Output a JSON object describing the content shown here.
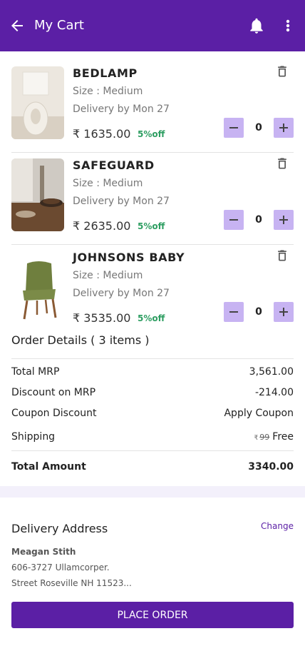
{
  "header": {
    "title": "My Cart",
    "background": "#5b1fa5",
    "icons": [
      "back-arrow-icon",
      "bell-icon",
      "more-vert-icon"
    ]
  },
  "cart": {
    "items": [
      {
        "name": "BEDLAMP",
        "size": "Size : Medium",
        "delivery": "Delivery by Mon 27",
        "price": "₹ 1635.00",
        "discount": "5%off",
        "quantity": "0"
      },
      {
        "name": "SAFEGUARD",
        "size": "Size : Medium",
        "delivery": "Delivery by Mon 27",
        "price": "₹ 2635.00",
        "discount": "5%off",
        "quantity": "0"
      },
      {
        "name": "JOHNSONS BABY",
        "size": "Size : Medium",
        "delivery": "Delivery by Mon 27",
        "price": "₹ 3535.00",
        "discount": "5%off",
        "quantity": "0"
      }
    ]
  },
  "order": {
    "heading": "Order Details ( 3 items )",
    "total_mrp_label": "Total MRP",
    "total_mrp_value": "3,561.00",
    "discount_label": "Discount on MRP",
    "discount_value": "-214.00",
    "coupon_label": "Coupon Discount",
    "coupon_value": "Apply Coupon",
    "shipping_label": "Shipping",
    "shipping_currency": "₹",
    "shipping_old": "99",
    "shipping_value": "Free",
    "total_label": "Total Amount",
    "total_value": "3340.00"
  },
  "address": {
    "title": "Delivery Address",
    "change_label": "Change",
    "name": "Meagan Stith",
    "line1": "606-3727 Ullamcorper.",
    "line2": "Street Roseville NH 11523..."
  },
  "actions": {
    "place_order_label": "PLACE ORDER"
  },
  "colors": {
    "accent": "#5b1fa5",
    "qty_button": "#c7b3f2",
    "discount_green": "#2e9e62"
  }
}
